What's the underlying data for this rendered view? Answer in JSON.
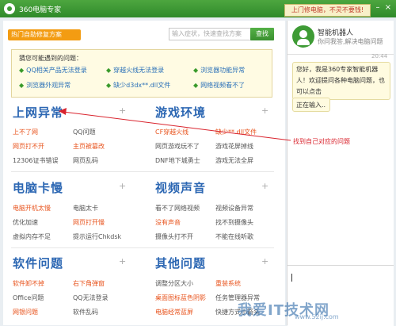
{
  "titlebar": {
    "app_title": "360电脑专家",
    "promo": "上门修电脑，不灵不要钱!",
    "minimize": "–",
    "close": "×"
  },
  "main": {
    "hot_tag": "热门自助修复方案",
    "search": {
      "placeholder": "输入症状，快速查找方案",
      "button": "查找"
    },
    "suggestions": {
      "title": "猜您可能遇到的问题：",
      "items": [
        "QQ相关产品无法登录",
        "穿越火线无法登录",
        "浏览器功能异常",
        "浏览器外观异常",
        "缺少d3dx**.dll文件",
        "网络视频看不了"
      ]
    },
    "sections": [
      {
        "title": "上网异常",
        "items": [
          {
            "label": "上不了网",
            "hot": true
          },
          {
            "label": "QQ问题",
            "hot": false
          },
          {
            "label": "网页打不开",
            "hot": true
          },
          {
            "label": "主页被篡改",
            "hot": true
          },
          {
            "label": "12306证书错误",
            "hot": false
          },
          {
            "label": "网页乱码",
            "hot": false
          }
        ]
      },
      {
        "title": "游戏环境",
        "items": [
          {
            "label": "CF穿越火线",
            "hot": true
          },
          {
            "label": "缺少**.dll文件",
            "hot": true
          },
          {
            "label": "网页游戏玩不了",
            "hot": false
          },
          {
            "label": "游戏花屏掉线",
            "hot": false
          },
          {
            "label": "DNF地下城勇士",
            "hot": false
          },
          {
            "label": "游戏无法全屏",
            "hot": false
          }
        ]
      },
      {
        "title": "电脑卡慢",
        "items": [
          {
            "label": "电脑开机太慢",
            "hot": true
          },
          {
            "label": "电脑太卡",
            "hot": false
          },
          {
            "label": "优化加速",
            "hot": false
          },
          {
            "label": "网页打开慢",
            "hot": true
          },
          {
            "label": "虚拟内存不足",
            "hot": false
          },
          {
            "label": "提示运行Chkdsk",
            "hot": false
          }
        ]
      },
      {
        "title": "视频声音",
        "items": [
          {
            "label": "看不了网络视频",
            "hot": false
          },
          {
            "label": "视频设备异常",
            "hot": false
          },
          {
            "label": "没有声音",
            "hot": true
          },
          {
            "label": "找不到摄像头",
            "hot": false
          },
          {
            "label": "摄像头打不开",
            "hot": false
          },
          {
            "label": "不能在线听歌",
            "hot": false
          }
        ]
      },
      {
        "title": "软件问题",
        "items": [
          {
            "label": "软件卸不掉",
            "hot": true
          },
          {
            "label": "右下角弹窗",
            "hot": true
          },
          {
            "label": "Office问题",
            "hot": false
          },
          {
            "label": "QQ无法登录",
            "hot": false
          },
          {
            "label": "网银问题",
            "hot": true
          },
          {
            "label": "软件乱码",
            "hot": false
          }
        ]
      },
      {
        "title": "其他问题",
        "items": [
          {
            "label": "调整分区大小",
            "hot": false
          },
          {
            "label": "重装系统",
            "hot": true
          },
          {
            "label": "桌面图标蓝色阴影",
            "hot": true
          },
          {
            "label": "任务管理器异常",
            "hot": false
          },
          {
            "label": "电脑经常蓝屏",
            "hot": true
          },
          {
            "label": "快捷方式小箭头",
            "hot": false
          }
        ]
      }
    ]
  },
  "annotation": "找到自己对应的问题",
  "chat": {
    "bot_name": "智能机器人",
    "bot_subtitle": "你问我答,解决电脑问题",
    "time": "20:44",
    "message": "您好，我是360专家智能机器人！欢迎提问各种电脑问题，也可以点击",
    "typing": "正在输入.."
  },
  "watermark": {
    "main": "我爱IT技术网",
    "url": "www.52ij.com"
  }
}
